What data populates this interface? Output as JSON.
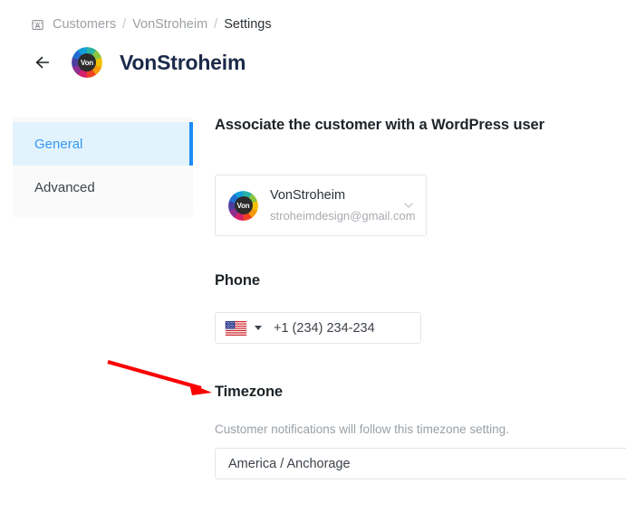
{
  "breadcrumb": {
    "icon": "customers-card-icon",
    "items": [
      {
        "label": "Customers",
        "current": false
      },
      {
        "label": "VonStroheim",
        "current": false
      },
      {
        "label": "Settings",
        "current": true
      }
    ],
    "separator": "/"
  },
  "header": {
    "back_icon": "arrow-left-icon",
    "avatar_initials": "Von",
    "title": "VonStroheim"
  },
  "sidebar": {
    "items": [
      {
        "label": "General",
        "active": true
      },
      {
        "label": "Advanced",
        "active": false
      }
    ]
  },
  "main": {
    "wordpress_user": {
      "heading": "Associate the customer with a WordPress user",
      "selected": {
        "avatar_initials": "Von",
        "name": "VonStroheim",
        "email": "stroheimdesign@gmail.com"
      },
      "chevron_icon": "chevron-down-icon"
    },
    "phone": {
      "heading": "Phone",
      "country_flag": "us-flag-icon",
      "caret_icon": "caret-down-icon",
      "value": "+1 (234) 234-234",
      "placeholder": "+1 (234) 234-234"
    },
    "timezone": {
      "heading": "Timezone",
      "description": "Customer notifications will follow this timezone setting.",
      "value": "America / Anchorage"
    }
  },
  "annotation": {
    "type": "arrow",
    "color": "#fb0000",
    "points_to": "Timezone"
  },
  "colors": {
    "accent_blue": "#1e8cf5",
    "active_bg": "#e2f3fd",
    "sidebar_bg": "#fafafa",
    "border": "#e3e5e8",
    "muted_text": "#9aa0a6",
    "annotation_red": "#fb0000"
  }
}
